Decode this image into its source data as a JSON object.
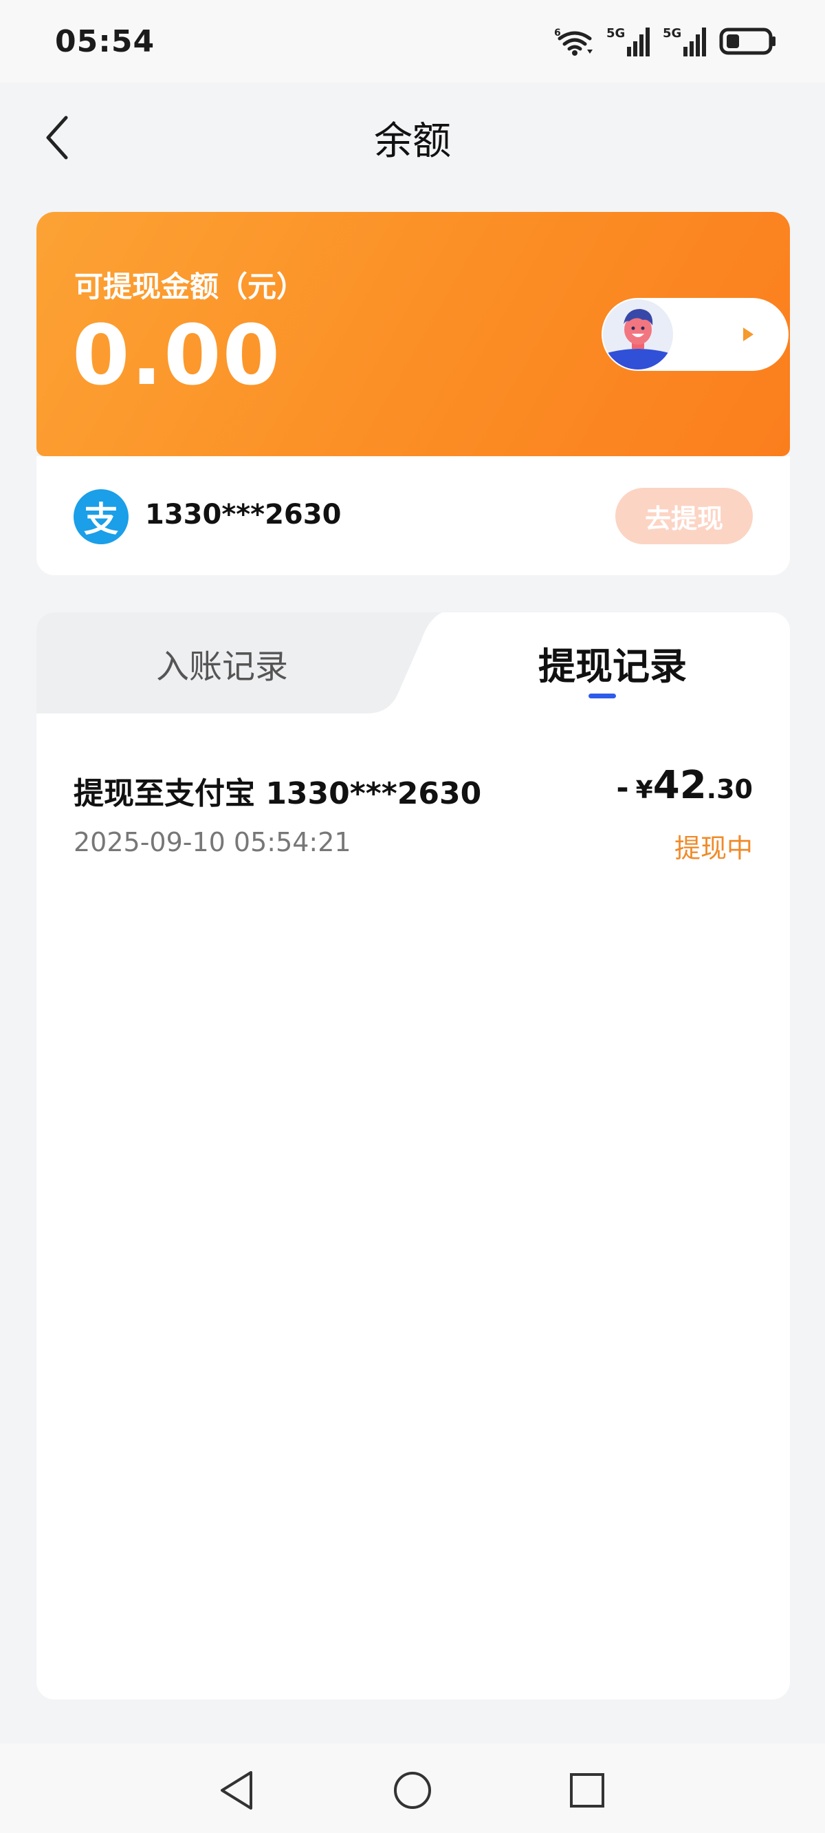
{
  "status_bar": {
    "time": "05:54",
    "wifi_label": "6",
    "sim1_label": "5G",
    "sim2_label": "5G",
    "icons": [
      "wifi-icon",
      "signal-icon",
      "signal-icon",
      "battery-icon"
    ]
  },
  "header": {
    "title": "余额",
    "back_icon": "chevron-left-icon"
  },
  "balance": {
    "label": "可提现金额（元）",
    "amount": "0.00",
    "promo_icons": [
      "avatar-icon",
      "play-icon"
    ],
    "gradient_colors": [
      "#fca234",
      "#fb7e1d"
    ]
  },
  "account": {
    "icon_char": "支",
    "number": "1330***2630",
    "withdraw_label": "去提现"
  },
  "tabs": [
    {
      "label": "入账记录",
      "active": false
    },
    {
      "label": "提现记录",
      "active": true
    }
  ],
  "records": [
    {
      "title": "提现至支付宝 1330***2630",
      "time": "2025-09-10 05:54:21",
      "amount_sign": "-",
      "currency": "¥",
      "amount_int": "42",
      "amount_dec": ".30",
      "status": "提现中"
    }
  ],
  "colors": {
    "accent_orange": "#fb8e25",
    "status_orange": "#f08a28",
    "tab_indicator": "#2f5bea",
    "alipay_blue": "#1a9fe8"
  },
  "system_nav": [
    "back-triangle-icon",
    "home-circle-icon",
    "recents-square-icon"
  ]
}
